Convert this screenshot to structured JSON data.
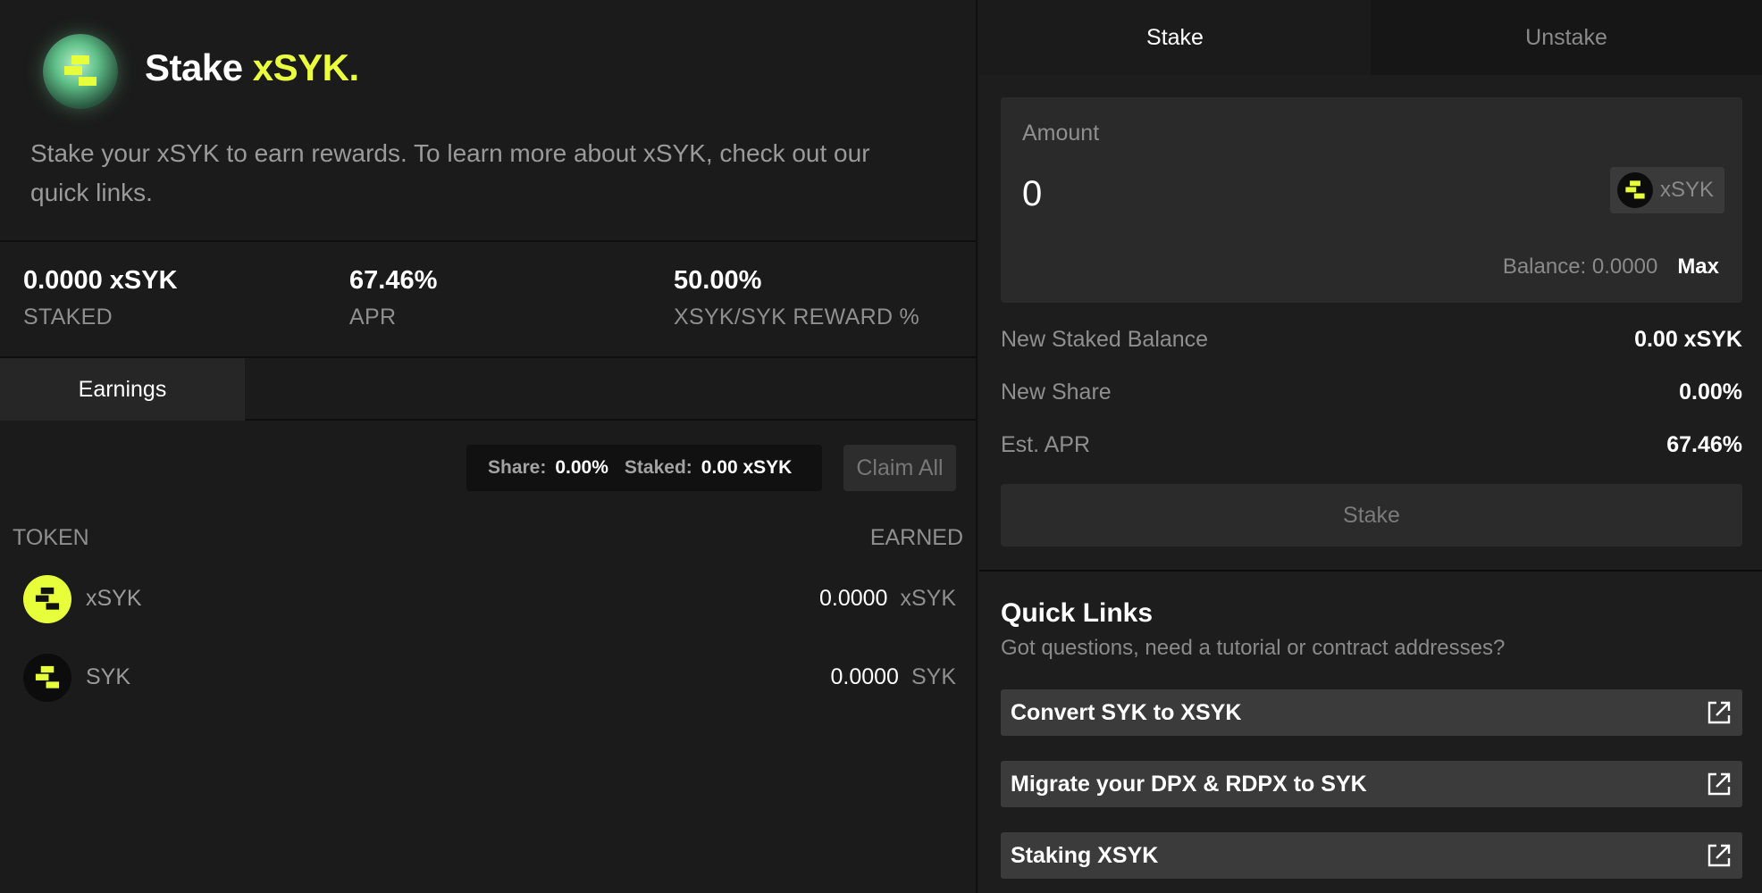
{
  "hero": {
    "title_prefix": "Stake ",
    "title_accent": "xSYK.",
    "description": "Stake your xSYK to earn rewards. To learn more about xSYK, check out our quick links."
  },
  "stats": [
    {
      "value": "0.0000 xSYK",
      "label": "STAKED"
    },
    {
      "value": "67.46%",
      "label": "APR"
    },
    {
      "value": "50.00%",
      "label": "XSYK/SYK REWARD %"
    }
  ],
  "earnings": {
    "tab_label": "Earnings",
    "share_label": "Share:",
    "share_value": "0.00%",
    "staked_label": "Staked:",
    "staked_value": "0.00 xSYK",
    "claim_label": "Claim All",
    "col_token": "TOKEN",
    "col_earned": "EARNED",
    "rows": [
      {
        "name": "xSYK",
        "amount": "0.0000",
        "symbol": "xSYK"
      },
      {
        "name": "SYK",
        "amount": "0.0000",
        "symbol": "SYK"
      }
    ]
  },
  "panel": {
    "tabs": [
      {
        "label": "Stake"
      },
      {
        "label": "Unstake"
      }
    ],
    "amount_label": "Amount",
    "amount_value": "0",
    "token_chip": "xSYK",
    "balance_label": "Balance: 0.0000",
    "max_label": "Max",
    "info": [
      {
        "label": "New Staked Balance",
        "value": "0.00 xSYK"
      },
      {
        "label": "New Share",
        "value": "0.00%"
      },
      {
        "label": "Est. APR",
        "value": "67.46%"
      }
    ],
    "stake_button": "Stake"
  },
  "quick_links": {
    "title": "Quick Links",
    "subtitle": "Got questions, need a tutorial or contract addresses?",
    "links": [
      {
        "label": "Convert SYK to XSYK"
      },
      {
        "label": "Migrate your DPX & RDPX to SYK"
      },
      {
        "label": "Staking XSYK"
      }
    ]
  },
  "colors": {
    "accent": "#eaff3d",
    "background": "#1b1b1b",
    "muted_text": "#8f8f8f"
  },
  "icons": [
    "syk-logo-icon",
    "external-link-icon"
  ]
}
